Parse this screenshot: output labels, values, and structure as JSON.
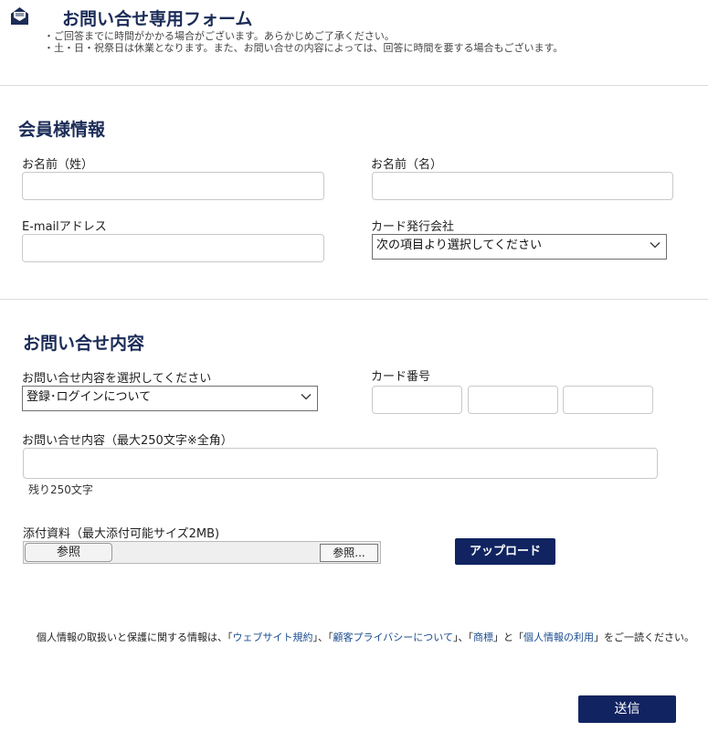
{
  "header": {
    "title": "お問い合せ専用フォーム",
    "notice_1": "・ご回答までに時間がかかる場合がございます。あらかじめご了承ください。",
    "notice_2": "・土・日・祝祭日は休業となります。また、お問い合せの内容によっては、回答に時間を要する場合もございます。",
    "icon": "envelope-icon"
  },
  "member_section": {
    "title": "会員様情報",
    "last_name_label": "お名前（姓）",
    "last_name_value": "",
    "first_name_label": "お名前（名）",
    "first_name_value": "",
    "email_label": "E-mailアドレス",
    "email_value": "",
    "card_company_label": "カード発行会社",
    "card_company_selected": "次の項目より選択してください"
  },
  "inquiry_section": {
    "title": "お問い合せ内容",
    "type_label": "お問い合せ内容を選択してください",
    "type_selected": "登録･ログインについて",
    "card_number_label": "カード番号",
    "card_number_values": [
      "",
      "",
      ""
    ],
    "content_label": "お問い合せ内容（最大250文字※全角）",
    "content_value": "",
    "remaining": "残り250文字",
    "attachment_label": "添付資料（最大添付可能サイズ2MB)",
    "file_button_left": "参照",
    "file_button_right": "参照...",
    "upload_button": "アップロード"
  },
  "privacy": {
    "prefix": "個人情報の取扱いと保護に関する情報は、「",
    "link1": "ウェブサイト規約",
    "sep1": "」、「",
    "link2": "顧客プライバシーについて",
    "sep2": "」、「",
    "link3": "商標",
    "sep3": "」と「",
    "link4": "個人情報の利用",
    "suffix": "」をご一読ください。"
  },
  "submit_button": "送信",
  "colors": {
    "navy": "#112461",
    "title": "#1b2c57",
    "link": "#1a4d8f"
  }
}
